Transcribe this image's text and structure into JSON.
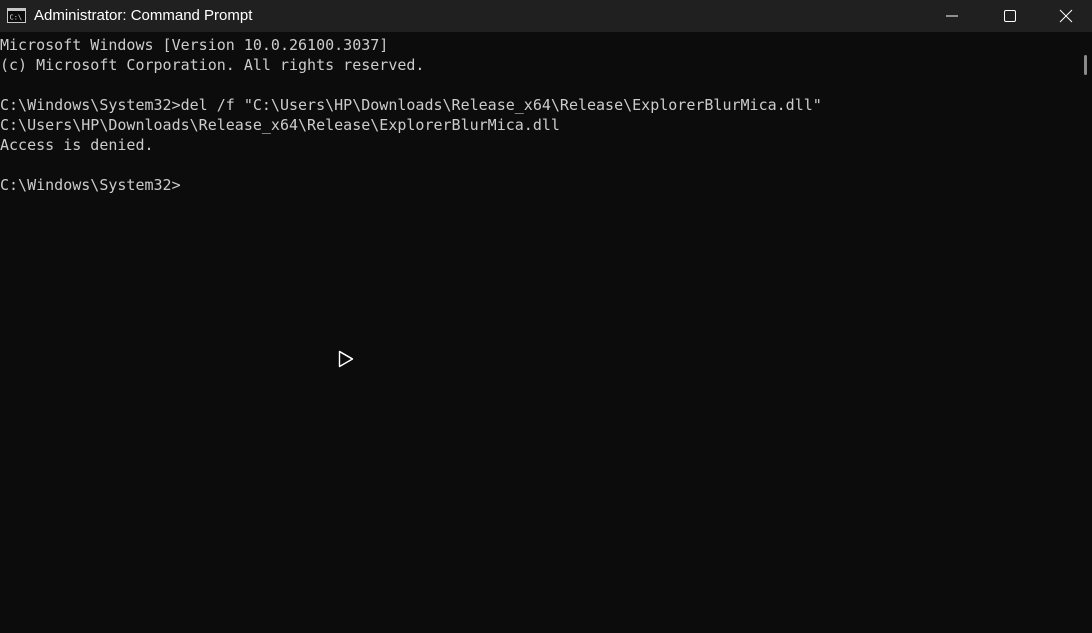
{
  "window": {
    "title": "Administrator: Command Prompt",
    "icon": "cmd-icon"
  },
  "controls": {
    "minimize_icon": "minimize-icon",
    "maximize_icon": "maximize-icon",
    "close_icon": "close-icon"
  },
  "terminal": {
    "lines": [
      "Microsoft Windows [Version 10.0.26100.3037]",
      "(c) Microsoft Corporation. All rights reserved.",
      "",
      "C:\\Windows\\System32>del /f \"C:\\Users\\HP\\Downloads\\Release_x64\\Release\\ExplorerBlurMica.dll\"",
      "C:\\Users\\HP\\Downloads\\Release_x64\\Release\\ExplorerBlurMica.dll",
      "Access is denied.",
      "",
      "C:\\Windows\\System32>"
    ]
  },
  "colors": {
    "titlebar": "#202020",
    "background": "#0c0c0c",
    "text": "#cccccc"
  }
}
